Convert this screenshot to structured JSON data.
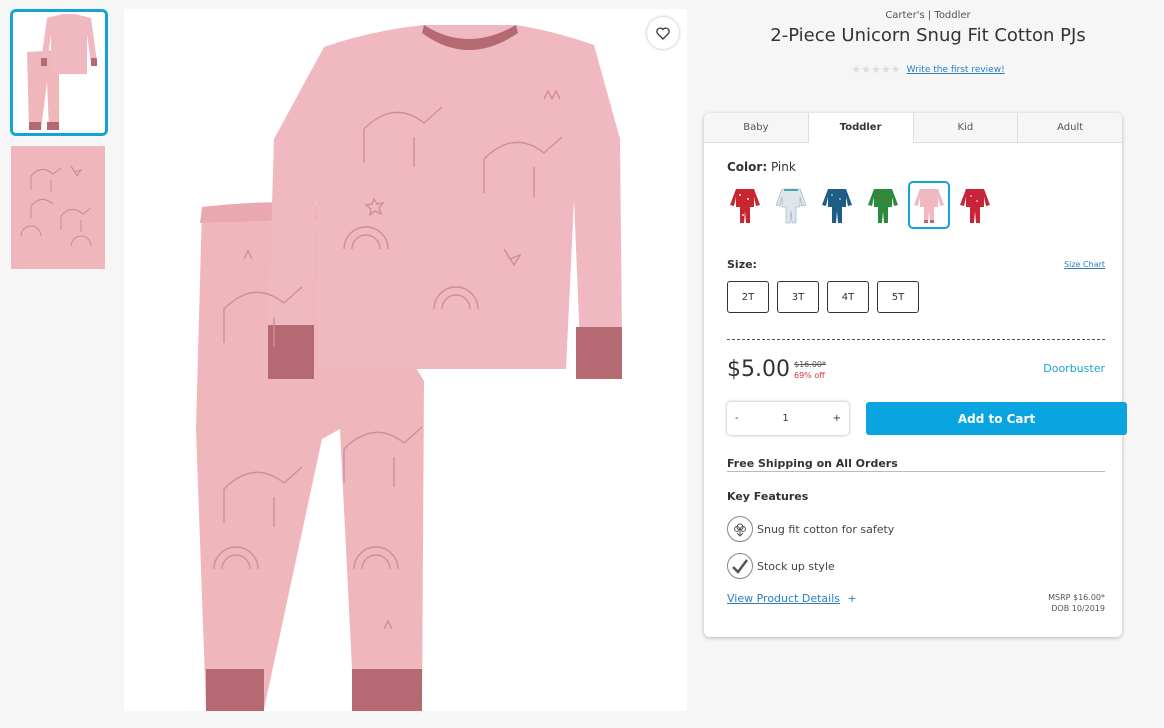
{
  "gallery": {
    "thumbnails": [
      "pajama-set-front",
      "fabric-print-closeup"
    ],
    "wishlist_icon": "heart-icon"
  },
  "product": {
    "brand_line": "Carter's | Toddler",
    "title": "2-Piece Unicorn Snug Fit Cotton PJs",
    "rating_stars": 0,
    "review_link": "Write the first review!"
  },
  "tabs": [
    {
      "label": "Baby",
      "active": false
    },
    {
      "label": "Toddler",
      "active": true
    },
    {
      "label": "Kid",
      "active": false
    },
    {
      "label": "Adult",
      "active": false
    }
  ],
  "color": {
    "label": "Color:",
    "value": "Pink",
    "swatches": [
      {
        "name": "red-print",
        "color": "#c8252f"
      },
      {
        "name": "white-print",
        "color": "#dfe5ea"
      },
      {
        "name": "navy-print",
        "color": "#1e5e86"
      },
      {
        "name": "green-print",
        "color": "#2c8a3c"
      },
      {
        "name": "pink-unicorn",
        "color": "#f0b8c0",
        "selected": true
      },
      {
        "name": "red-heart",
        "color": "#c7243a"
      }
    ]
  },
  "size": {
    "label": "Size:",
    "chart_link": "Size Chart",
    "options": [
      "2T",
      "3T",
      "4T",
      "5T"
    ]
  },
  "pricing": {
    "price": "$5.00",
    "was": "$16.00*",
    "discount": "69% off",
    "promo": "Doorbuster"
  },
  "quantity": {
    "minus": "-",
    "value": "1",
    "plus": "+"
  },
  "cart": {
    "button_label": "Add to Cart"
  },
  "shipping": {
    "label": "Free Shipping on All Orders"
  },
  "features": {
    "title": "Key Features",
    "items": [
      {
        "icon": "cotton-icon",
        "label": "Snug fit cotton for safety"
      },
      {
        "icon": "checkmark-icon",
        "label": "Stock up style"
      }
    ]
  },
  "details": {
    "link": "View Product Details",
    "link_icon": "+",
    "msrp": "MSRP $16.00*",
    "dob": "DOB 10/2019"
  },
  "colors": {
    "accent": "#15a3d6",
    "cart_button": "#0aa5e0",
    "sale_red": "#d9343c",
    "pajama_pink": "#efb6bc",
    "cuff_mauve": "#b56a73"
  }
}
